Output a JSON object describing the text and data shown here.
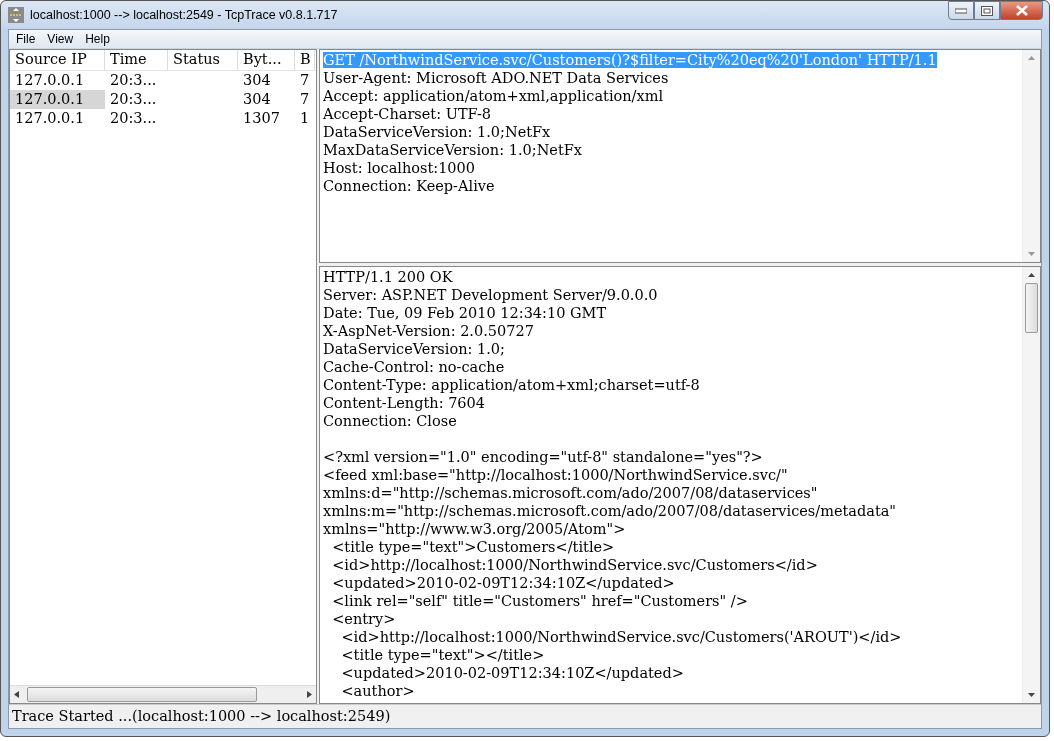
{
  "window": {
    "title": "localhost:1000 --> localhost:2549 - TcpTrace v0.8.1.717"
  },
  "menu": [
    "File",
    "View",
    "Help"
  ],
  "table": {
    "columns": [
      "Source IP",
      "Time",
      "Status",
      "Byt...",
      "B"
    ],
    "rows": [
      {
        "selected": false,
        "cells": [
          "127.0.0.1",
          "20:3...",
          "",
          "304",
          "7"
        ]
      },
      {
        "selected": true,
        "cells": [
          "127.0.0.1",
          "20:3...",
          "",
          "304",
          "7"
        ]
      },
      {
        "selected": false,
        "cells": [
          "127.0.0.1",
          "20:3...",
          "",
          "1307",
          "1"
        ]
      }
    ]
  },
  "request": {
    "lines": [
      {
        "text": "GET /NorthwindService.svc/Customers()?$filter=City%20eq%20'London' HTTP/1.1",
        "selected": true
      },
      {
        "text": "User-Agent: Microsoft ADO.NET Data Services",
        "selected": false
      },
      {
        "text": "Accept: application/atom+xml,application/xml",
        "selected": false
      },
      {
        "text": "Accept-Charset: UTF-8",
        "selected": false
      },
      {
        "text": "DataServiceVersion: 1.0;NetFx",
        "selected": false
      },
      {
        "text": "MaxDataServiceVersion: 1.0;NetFx",
        "selected": false
      },
      {
        "text": "Host: localhost:1000",
        "selected": false
      },
      {
        "text": "Connection: Keep-Alive",
        "selected": false
      }
    ]
  },
  "response": {
    "headers": [
      "HTTP/1.1 200 OK",
      "Server: ASP.NET Development Server/9.0.0.0",
      "Date: Tue, 09 Feb 2010 12:34:10 GMT",
      "X-AspNet-Version: 2.0.50727",
      "DataServiceVersion: 1.0;",
      "Cache-Control: no-cache",
      "Content-Type: application/atom+xml;charset=utf-8",
      "Content-Length: 7604",
      "Connection: Close"
    ],
    "body": [
      "<?xml version=\"1.0\" encoding=\"utf-8\" standalone=\"yes\"?>",
      "<feed xml:base=\"http://localhost:1000/NorthwindService.svc/\"",
      "xmlns:d=\"http://schemas.microsoft.com/ado/2007/08/dataservices\"",
      "xmlns:m=\"http://schemas.microsoft.com/ado/2007/08/dataservices/metadata\"",
      "xmlns=\"http://www.w3.org/2005/Atom\">",
      "  <title type=\"text\">Customers</title>",
      "  <id>http://localhost:1000/NorthwindService.svc/Customers</id>",
      "  <updated>2010-02-09T12:34:10Z</updated>",
      "  <link rel=\"self\" title=\"Customers\" href=\"Customers\" />",
      "  <entry>",
      "    <id>http://localhost:1000/NorthwindService.svc/Customers('AROUT')</id>",
      "    <title type=\"text\"></title>",
      "    <updated>2010-02-09T12:34:10Z</updated>",
      "    <author>"
    ]
  },
  "status_bar": "Trace Started ...(localhost:1000 --> localhost:2549)"
}
